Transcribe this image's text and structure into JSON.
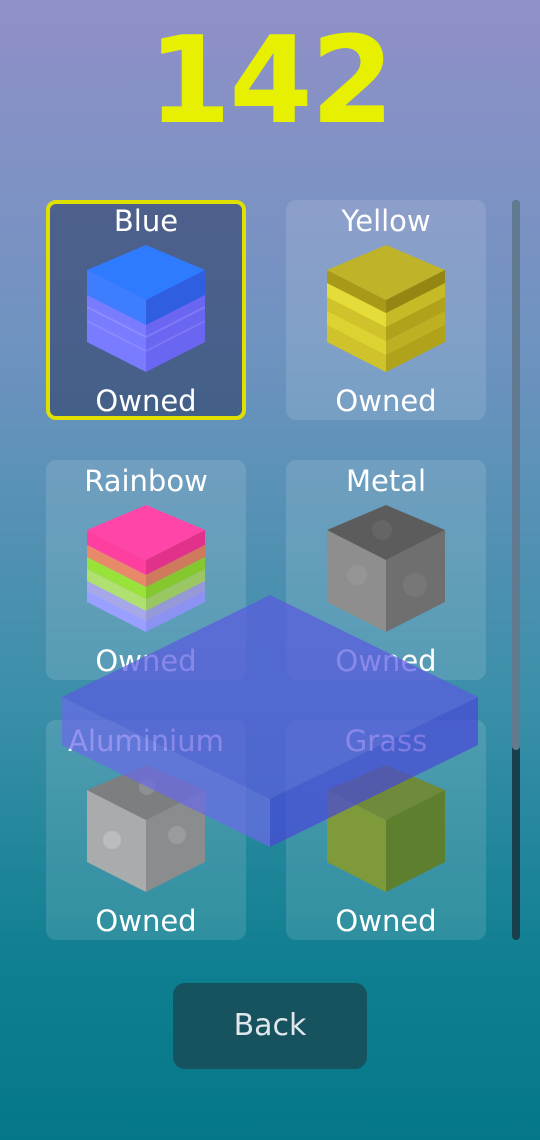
{
  "score": "142",
  "colors": {
    "score": "#e6f000",
    "selected_border": "#e0e000"
  },
  "skins": [
    {
      "name": "Blue",
      "status": "Owned",
      "selected": true,
      "icon": "blue-cube-icon"
    },
    {
      "name": "Yellow",
      "status": "Owned",
      "selected": false,
      "icon": "yellow-cube-icon"
    },
    {
      "name": "Rainbow",
      "status": "Owned",
      "selected": false,
      "icon": "rainbow-cube-icon"
    },
    {
      "name": "Metal",
      "status": "Owned",
      "selected": false,
      "icon": "metal-cube-icon"
    },
    {
      "name": "Aluminium",
      "status": "Owned",
      "selected": false,
      "icon": "aluminium-cube-icon"
    },
    {
      "name": "Grass",
      "status": "Owned",
      "selected": false,
      "icon": "grass-cube-icon"
    }
  ],
  "back_label": "Back"
}
